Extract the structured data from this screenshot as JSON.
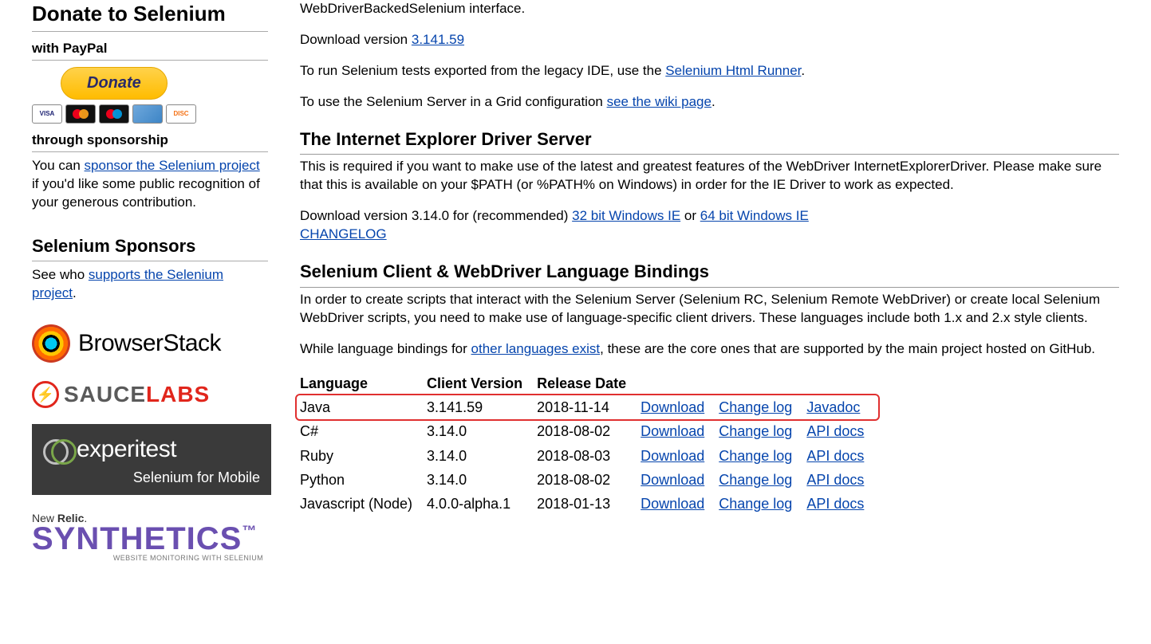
{
  "sidebar": {
    "donate_h1": "Donate to Selenium",
    "paypal_h2": "with PayPal",
    "donate_btn": "Donate",
    "sponsorship_h2": "through sponsorship",
    "sponsorship_pre": "You can ",
    "sponsorship_link": "sponsor the Selenium project",
    "sponsorship_post": " if you'd like some public recognition of your generous contribution.",
    "sponsors_h3": "Selenium Sponsors",
    "sponsors_pre": "See who ",
    "sponsors_link": "supports the Selenium project",
    "sponsors_post": ".",
    "browserstack": "BrowserStack",
    "sauce_gray": "SAUCE",
    "sauce_red": "LABS",
    "experitest_name": "experitest",
    "experitest_sub": "Selenium for Mobile",
    "newrelic_a": "New ",
    "newrelic_b": "Relic",
    "newrelic_dot": ".",
    "syn_big": "SYNTHETICS",
    "syn_sub": "WEBSITE MONITORING WITH SELENIUM",
    "syn_tm": "™"
  },
  "main": {
    "intro_tail": "WebDriverBackedSelenium interface.",
    "dl_pre": "Download version ",
    "dl_link": "3.141.59",
    "legacy_pre": "To run Selenium tests exported from the legacy IDE, use the ",
    "legacy_link": "Selenium Html Runner",
    "legacy_post": ".",
    "grid_pre": "To use the Selenium Server in a Grid configuration ",
    "grid_link": "see the wiki page",
    "grid_post": ".",
    "ie_h2": "The Internet Explorer Driver Server",
    "ie_body": "This is required if you want to make use of the latest and greatest features of the WebDriver InternetExplorerDriver. Please make sure that this is available on your $PATH (or %PATH% on Windows) in order for the IE Driver to work as expected.",
    "ie_dl_pre": "Download version 3.14.0 for (recommended) ",
    "ie_dl_32": "32 bit Windows IE",
    "ie_dl_or": " or ",
    "ie_dl_64": "64 bit Windows IE",
    "ie_changelog": "CHANGELOG",
    "bind_h2": "Selenium Client & WebDriver Language Bindings",
    "bind_body": "In order to create scripts that interact with the Selenium Server (Selenium RC, Selenium Remote WebDriver) or create local Selenium WebDriver scripts, you need to make use of language-specific client drivers. These languages include both 1.x and 2.x style clients.",
    "bind_other_pre": "While language bindings for ",
    "bind_other_link": "other languages exist",
    "bind_other_post": ", these are the core ones that are supported by the main project hosted on GitHub.",
    "headers": {
      "language": "Language",
      "version": "Client Version",
      "date": "Release Date"
    },
    "rows": [
      {
        "lang": "Java",
        "ver": "3.141.59",
        "date": "2018-11-14",
        "dl": "Download",
        "cl": "Change log",
        "doc": "Javadoc"
      },
      {
        "lang": "C#",
        "ver": "3.14.0",
        "date": "2018-08-02",
        "dl": "Download",
        "cl": "Change log",
        "doc": "API docs"
      },
      {
        "lang": "Ruby",
        "ver": "3.14.0",
        "date": "2018-08-03",
        "dl": "Download",
        "cl": "Change log",
        "doc": "API docs"
      },
      {
        "lang": "Python",
        "ver": "3.14.0",
        "date": "2018-08-02",
        "dl": "Download",
        "cl": "Change log",
        "doc": "API docs"
      },
      {
        "lang": "Javascript (Node)",
        "ver": "4.0.0-alpha.1",
        "date": "2018-01-13",
        "dl": "Download",
        "cl": "Change log",
        "doc": "API docs"
      }
    ]
  }
}
